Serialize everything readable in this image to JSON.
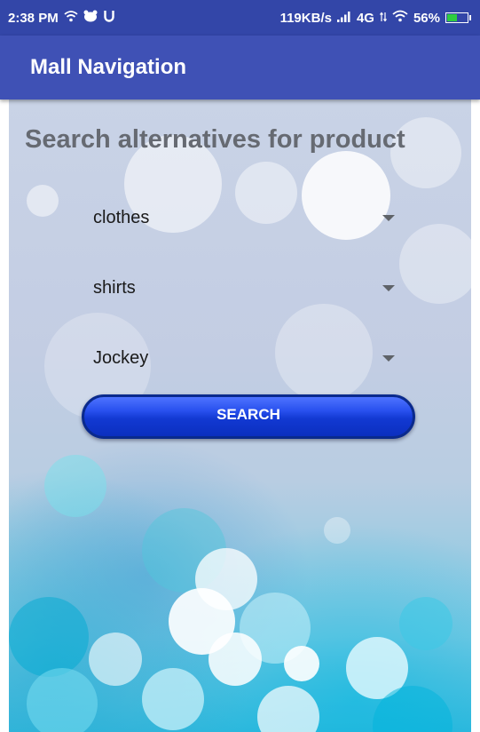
{
  "status_bar": {
    "time": "2:38 PM",
    "left_icons": [
      "wifi-hotspot-icon",
      "notification-icon",
      "u-icon"
    ],
    "network_speed": "119KB/s",
    "network_type": "4G",
    "battery": "56%",
    "battery_level": 0.56
  },
  "app_bar": {
    "title": "Mall Navigation",
    "color": "#3f51b5"
  },
  "main": {
    "heading": "Search alternatives for product",
    "dropdowns": [
      {
        "selected": "clothes"
      },
      {
        "selected": "shirts"
      },
      {
        "selected": "Jockey"
      }
    ],
    "search_button": "SEARCH",
    "button_color": "#1a40d8"
  }
}
